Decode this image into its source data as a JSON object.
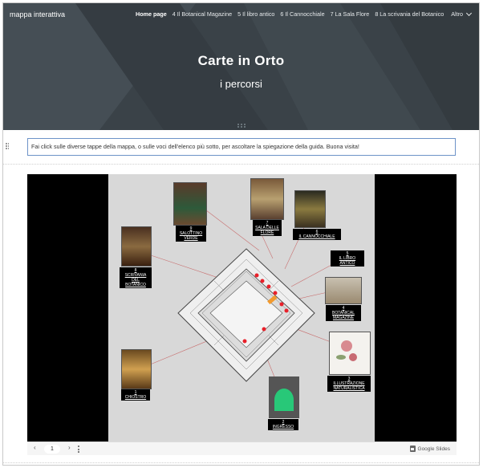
{
  "header": {
    "site_title": "mappa interattiva",
    "nav": [
      {
        "label": "Home page",
        "active": true
      },
      {
        "label": "4 Il Botanical Magazine"
      },
      {
        "label": "5 Il libro antico"
      },
      {
        "label": "6 Il Cannocchiale"
      },
      {
        "label": "7 La Sala Flore"
      },
      {
        "label": "8 La scrivania del Botanico"
      }
    ],
    "more_label": "Altro",
    "title": "Carte in Orto",
    "subtitle": "i percorsi"
  },
  "instruction": "Fai click sulle diverse tappe  della mappa, o sulle voci dell'elenco più sotto, per ascoltare la spiegazione della guida. Buona visita!",
  "slide": {
    "stops": [
      {
        "num": "1",
        "text": "CHIOSTRO"
      },
      {
        "num": "2",
        "text": "INGRESSO"
      },
      {
        "num": "3",
        "text": "ILLUSTRAZIONE NATURALISTICA"
      },
      {
        "num": "4",
        "text": "BOTANICAL MAGAZINE"
      },
      {
        "num": "5",
        "text": "IL LIBRO ANTICO"
      },
      {
        "num": "6",
        "text": "IL CANNOCCHIALE"
      },
      {
        "num": "7",
        "text": "SALA DELLE FLORE"
      },
      {
        "num": "8",
        "text": "SCRIVANIA DEL BOTANICO"
      },
      {
        "num": "9",
        "text": "SALOTTINO VERDE"
      }
    ]
  },
  "controls": {
    "prev": "‹",
    "page": "1",
    "next": "›",
    "brand": "Google Slides"
  },
  "colors": {
    "header_bg": "#3a4248",
    "accent_border": "#6d93c8",
    "marker": "#e8202a",
    "marker_orange": "#f29a2e"
  }
}
